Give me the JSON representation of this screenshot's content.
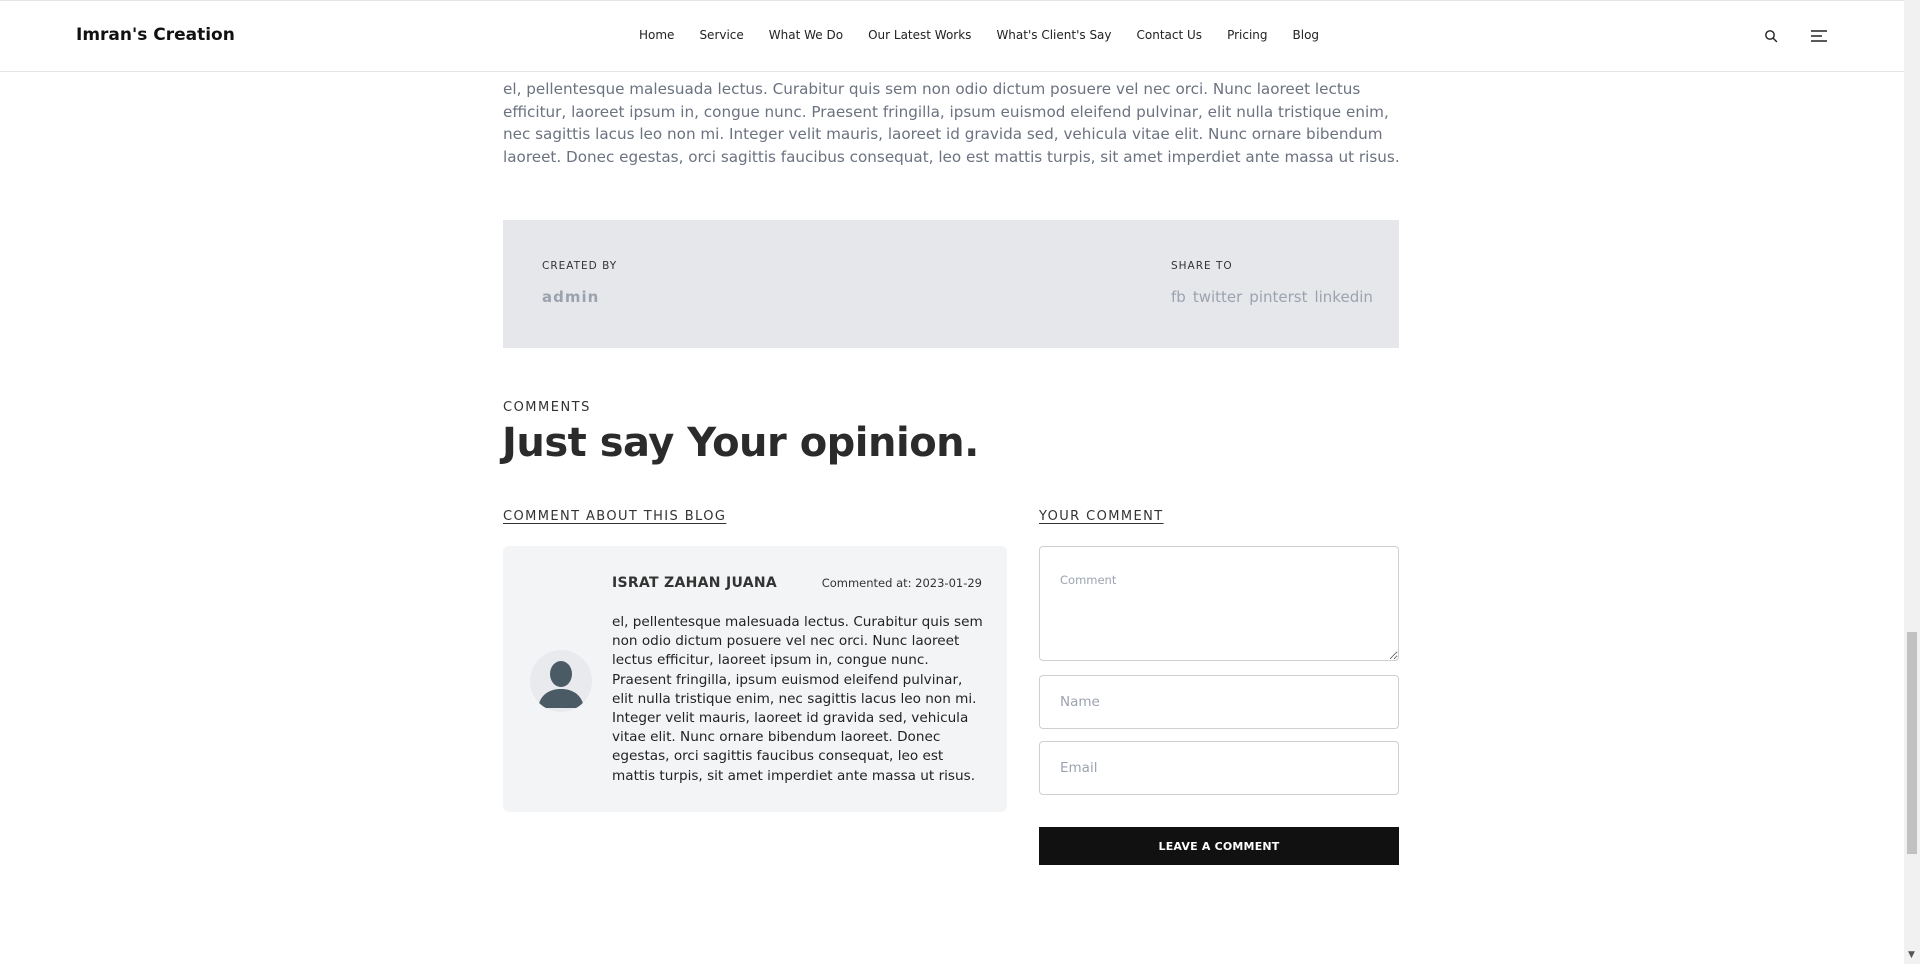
{
  "header": {
    "logo": "Imran's Creation",
    "nav": [
      "Home",
      "Service",
      "What We Do",
      "Our Latest Works",
      "What's Client's Say",
      "Contact Us",
      "Pricing",
      "Blog"
    ],
    "icons": [
      "search-icon",
      "menu-icon"
    ]
  },
  "article": {
    "intro": "el, pellentesque malesuada lectus. Curabitur quis sem non odio dictum posuere vel nec orci. Nunc laoreet lectus efficitur, laoreet ipsum in, congue nunc. Praesent fringilla, ipsum euismod eleifend pulvinar, elit nulla tristique enim, nec sagittis lacus leo non mi. Integer velit mauris, laoreet id gravida sed, vehicula vitae elit. Nunc ornare bibendum laoreet. Donec egestas, orci sagittis faucibus consequat, leo est mattis turpis, sit amet imperdiet ante massa ut risus."
  },
  "meta": {
    "created_by_label": "CREATED BY",
    "author": "admin",
    "share_label": "SHARE TO",
    "share_links": [
      "fb",
      "twitter",
      "pinterst",
      "linkedin"
    ]
  },
  "comments": {
    "kicker": "COMMENTS",
    "title": "Just say Your opinion.",
    "list_heading": "COMMENT ABOUT THIS BLOG",
    "form_heading": "YOUR COMMENT",
    "items": [
      {
        "name": "ISRAT ZAHAN JUANA",
        "date": "Commented at: 2023-01-29",
        "body": "el, pellentesque malesuada lectus. Curabitur quis sem non odio dictum posuere vel nec orci. Nunc laoreet lectus efficitur, laoreet ipsum in, congue nunc. Praesent fringilla, ipsum euismod eleifend pulvinar, elit nulla tristique enim, nec sagittis lacus leo non mi. Integer velit mauris, laoreet id gravida sed, vehicula vitae elit. Nunc ornare bibendum laoreet. Donec egestas, orci sagittis faucibus consequat, leo est mattis turpis, sit amet imperdiet ante massa ut risus."
      }
    ],
    "form": {
      "comment_placeholder": "Comment",
      "name_placeholder": "Name",
      "email_placeholder": "Email",
      "submit_label": "LEAVE A COMMENT"
    }
  },
  "colors": {
    "meta_bg": "#e5e7eb",
    "card_bg": "#f3f4f6",
    "button_bg": "#111111",
    "muted_text": "#9ca3af"
  }
}
